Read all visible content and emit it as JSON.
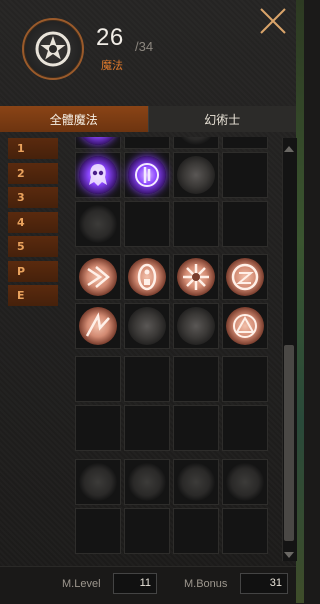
{
  "header": {
    "count": "26",
    "max": "/34",
    "label": "魔法",
    "emblem_icon": "pentagram-icon",
    "close_icon": "close-icon"
  },
  "tabs": [
    {
      "label": "全體魔法",
      "active": true
    },
    {
      "label": "幻術士",
      "active": false
    }
  ],
  "filters": [
    "1",
    "2",
    "3",
    "4",
    "5",
    "P",
    "E"
  ],
  "grid": {
    "rows": [
      [
        "purple-partial",
        "empty",
        "dark-partial",
        "empty"
      ],
      [
        "purple-skull-icon",
        "purple-spirit-icon",
        "dim-figure-icon",
        "empty"
      ],
      [
        "dim-claw-icon",
        "empty",
        "empty",
        "empty"
      ],
      [
        "salmon-burst-icon",
        "salmon-mask-icon",
        "salmon-star-icon",
        "salmon-rune-icon"
      ],
      [
        "salmon-shards-icon",
        "dim-tendril-icon",
        "dim-circle-icon",
        "salmon-orb-icon"
      ],
      [
        "empty",
        "empty",
        "empty",
        "empty"
      ],
      [
        "empty",
        "empty",
        "empty",
        "empty"
      ],
      [
        "dim-slash-icon",
        "dim-burst-icon",
        "dim-wing-icon",
        "dim-swirl-icon"
      ],
      [
        "empty",
        "empty",
        "empty",
        "empty"
      ]
    ]
  },
  "footer": {
    "level_label": "M.Level",
    "level_value": "11",
    "bonus_label": "M.Bonus",
    "bonus_value": "31"
  },
  "colors": {
    "accent_orange": "#e07a2c",
    "tab_active": "#8a4416",
    "filter_bg": "#5a2a0e"
  }
}
